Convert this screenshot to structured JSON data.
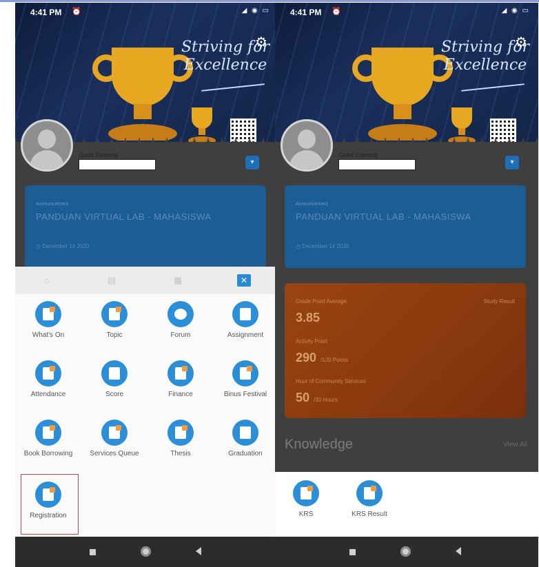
{
  "status_bar": {
    "time": "4:41 PM",
    "alarm_icon": "alarm-icon",
    "battery": "98"
  },
  "banner": {
    "tagline_line1": "Striving for",
    "tagline_line2": "Excellence",
    "gear_icon": "gear-icon"
  },
  "profile": {
    "greeting": "Good Evening"
  },
  "announcement": {
    "label": "Announcement",
    "title": "PANDUAN VIRTUAL LAB - MAHASISWA",
    "date": "December 14 2020"
  },
  "menu": {
    "tabs": [
      {
        "icon": "home-icon",
        "glyph": "⌂"
      },
      {
        "icon": "document-icon",
        "glyph": "▤"
      },
      {
        "icon": "grid-icon",
        "glyph": "▦"
      },
      {
        "icon": "close-icon",
        "glyph": "✕"
      }
    ],
    "items": [
      {
        "label": "What's On",
        "icon": "calendar-icon"
      },
      {
        "label": "Topic",
        "icon": "topic-icon"
      },
      {
        "label": "Forum",
        "icon": "chat-icon"
      },
      {
        "label": "Assignment",
        "icon": "clipboard-icon"
      },
      {
        "label": "Attendance",
        "icon": "attendance-icon"
      },
      {
        "label": "Score",
        "icon": "score-icon"
      },
      {
        "label": "Finance",
        "icon": "wallet-icon"
      },
      {
        "label": "Binus Festival",
        "icon": "festival-icon"
      },
      {
        "label": "Book Borrowing",
        "icon": "book-icon"
      },
      {
        "label": "Services Queue",
        "icon": "queue-icon"
      },
      {
        "label": "Thesis",
        "icon": "thesis-icon"
      },
      {
        "label": "Graduation",
        "icon": "graduation-cap-icon"
      },
      {
        "label": "Registration",
        "icon": "registration-icon"
      }
    ]
  },
  "stats": {
    "gpa_label": "Grade Point Average",
    "gpa_link": "Study Result",
    "gpa_value": "3.85",
    "activity_label": "Activity Point",
    "activity_value": "290",
    "activity_unit": "/120 Points",
    "community_label": "Hour of Community Services",
    "community_value": "50",
    "community_unit": "/30 Hours"
  },
  "knowledge": {
    "title": "Knowledge",
    "view_all": "View All"
  },
  "registration_submenu": [
    {
      "label": "KRS",
      "icon": "krs-icon"
    },
    {
      "label": "KRS Result",
      "icon": "krs-result-icon"
    }
  ],
  "colors": {
    "accent": "#2b8ed8",
    "highlight": "#c9474c",
    "gpa_card": "#8a3a0e"
  }
}
